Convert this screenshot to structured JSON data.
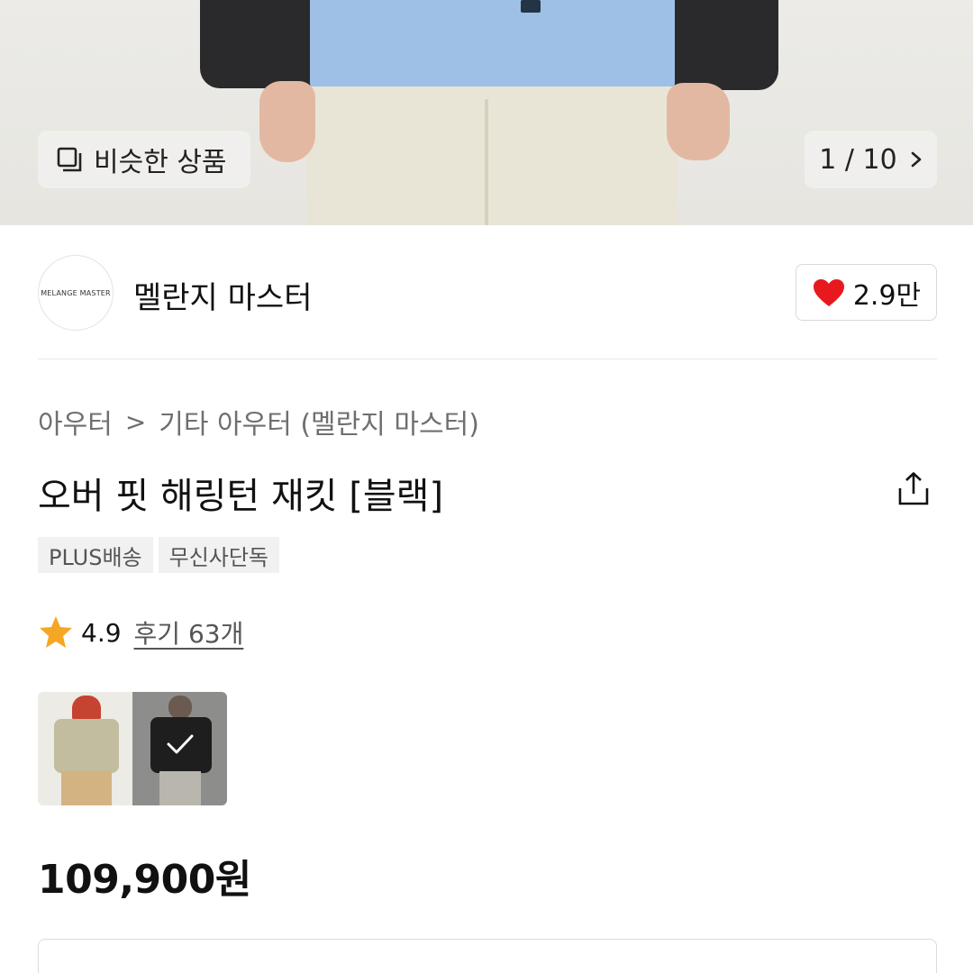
{
  "hero": {
    "similar_label": "비슷한 상품",
    "similar_icon": "similar-products-icon",
    "pager": "1 / 10",
    "pager_icon": "chevron-right-icon"
  },
  "brand": {
    "logo_text": "MELANGE MASTER",
    "name": "멜란지 마스터",
    "like_icon": "heart-icon",
    "like_color": "#e8191e",
    "like_count": "2.9만"
  },
  "breadcrumb": {
    "category": "아우터",
    "separator": ">",
    "subcategory": "기타 아우터 (멜란지 마스터)"
  },
  "product": {
    "title": "오버 핏 해링턴 재킷 [블랙]",
    "share_icon": "share-icon",
    "tags": [
      "PLUS배송",
      "무신사단독"
    ],
    "rating": "4.9",
    "rating_icon": "star-icon",
    "rating_color": "#f5a623",
    "reviews": "후기 63개",
    "color_options": [
      {
        "name": "color-option-beige",
        "selected": false
      },
      {
        "name": "color-option-black",
        "selected": true
      }
    ],
    "price": "109,900원"
  }
}
